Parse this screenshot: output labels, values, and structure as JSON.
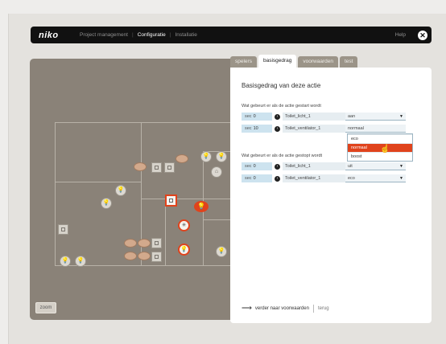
{
  "nav": {
    "logo": "niko",
    "items": [
      {
        "label": "Project management",
        "active": false
      },
      {
        "label": "Configuratie",
        "active": true
      },
      {
        "label": "Installatie",
        "active": false
      }
    ],
    "help": "Help",
    "close_icon": "close-icon"
  },
  "canvas": {
    "zoom_label": "zoom"
  },
  "tabs": [
    {
      "label": "spelers",
      "active": false
    },
    {
      "label": "basisgedrag",
      "active": true
    },
    {
      "label": "voorwaarden",
      "active": false
    },
    {
      "label": "test",
      "active": false
    }
  ],
  "panel": {
    "title": "Basisgedrag van deze actie",
    "start_question": "Wat gebeurt er als de actie gestart wordt",
    "stop_question": "Wat gebeurt er als de actie gestopt wordt",
    "start_rows": [
      {
        "unit": "sec",
        "time": "0",
        "target": "Toilet_licht_1",
        "value": "aan"
      },
      {
        "unit": "sec",
        "time": "10",
        "target": "Toilet_ventilator_1",
        "value": "normaal"
      }
    ],
    "stop_rows": [
      {
        "unit": "sec",
        "time": "0",
        "target": "Toilet_licht_1",
        "value": "uit"
      },
      {
        "unit": "sec",
        "time": "0",
        "target": "Toilet_ventilator_1",
        "value": "eco"
      }
    ],
    "dropdown_options": [
      "eco",
      "normaal",
      "boost"
    ],
    "dropdown_highlight": "normaal",
    "footer_next": "verder naar voorwaarden",
    "footer_back": "terug"
  },
  "colors": {
    "accent": "#e0431c",
    "navbar": "#111111",
    "canvas": "#8a8278",
    "time_cell": "#cde3ef"
  }
}
